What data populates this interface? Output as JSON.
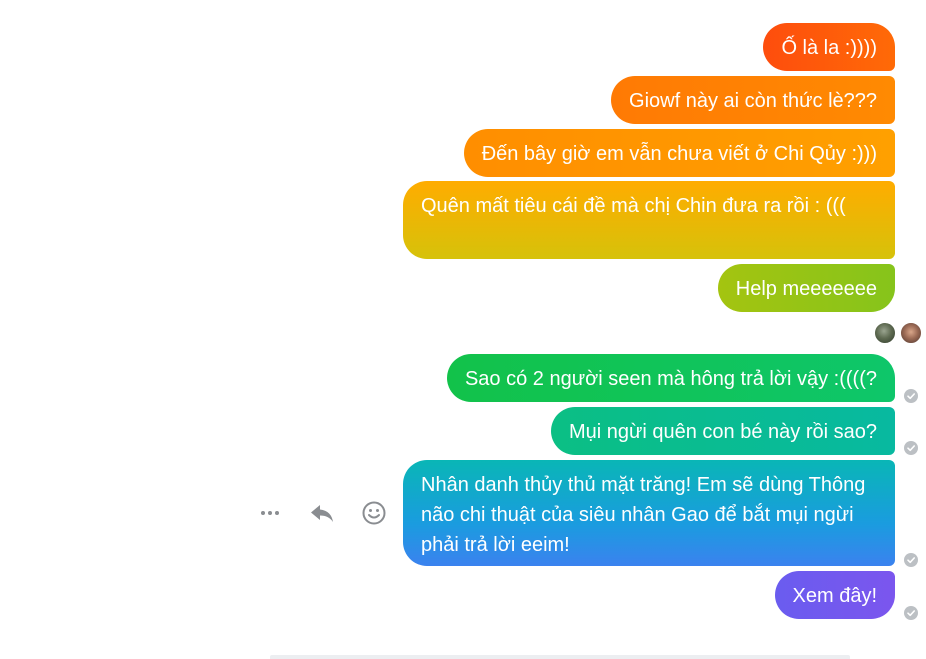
{
  "messages": [
    {
      "text": "Ố là la :))))"
    },
    {
      "text": "Giowf này ai còn thức lè???"
    },
    {
      "text": "Đến bây giờ em vẫn chưa viết ở Chi Qủy :)))"
    },
    {
      "text": "Quên mất tiêu cái đề mà chị Chin đưa ra rồi : ((("
    },
    {
      "text": "Help meeeeeee"
    },
    {
      "text": "Sao có 2 người seen mà hông trả lời vậy :((((?"
    },
    {
      "text": "Mụi ngừi quên con bé này rồi sao?"
    },
    {
      "text": "Nhân danh thủy thủ mặt trăng! Em sẽ dùng Thông não chi thuật của siêu nhân Gao để bắt mụi ngừi phải trả lời eeim!"
    },
    {
      "text": "Xem đây!"
    }
  ],
  "icons": {
    "more": "more-options-icon",
    "reply": "reply-icon",
    "react": "emoji-react-icon",
    "sent": "sent-check-icon",
    "seen_avatar": "seen-avatar"
  },
  "colors": {
    "status_gray": "#bcc0c4",
    "action_gray": "#8a8d91"
  }
}
